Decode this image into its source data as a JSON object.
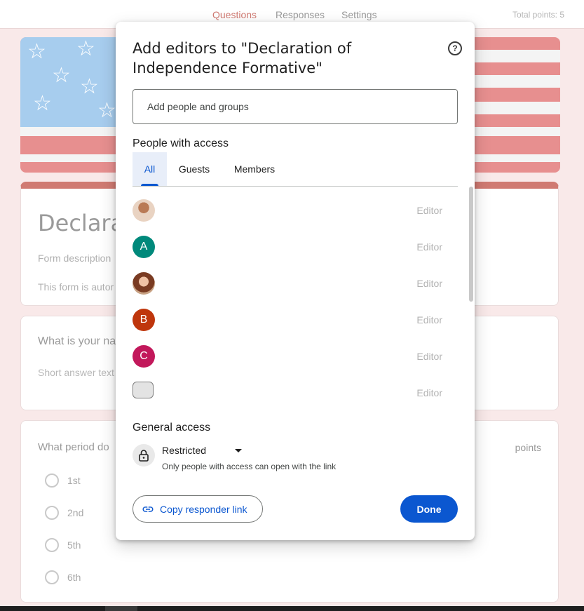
{
  "topbar": {
    "tabs": [
      "Questions",
      "Responses",
      "Settings"
    ],
    "total_points": "Total points: 5"
  },
  "form": {
    "title_visible": "Declarat",
    "description_placeholder": "Form description",
    "auto_text_visible": "This form is autor",
    "q1_label_visible": "What is your nar",
    "q1_answer_placeholder": "Short answer text",
    "q2_label_visible": "What period do",
    "q2_points": "points",
    "q2_options": [
      "1st",
      "2nd",
      "5th",
      "6th"
    ]
  },
  "dialog": {
    "title": "Add editors to \"Declaration of Independence Formative\"",
    "help_icon": "help-circle-icon",
    "add_placeholder": "Add people and groups",
    "people_heading": "People with access",
    "tabs": [
      "All",
      "Guests",
      "Members"
    ],
    "active_tab": "All",
    "people": [
      {
        "avatar": "photo",
        "initial": "",
        "role": "Editor"
      },
      {
        "avatar": "letter",
        "initial": "A",
        "color": "#00897b",
        "role": "Editor"
      },
      {
        "avatar": "photo",
        "initial": "",
        "role": "Editor"
      },
      {
        "avatar": "letter",
        "initial": "B",
        "color": "#bf360c",
        "role": "Editor"
      },
      {
        "avatar": "letter",
        "initial": "C",
        "color": "#c2185b",
        "role": "Editor"
      },
      {
        "avatar": "photo",
        "initial": "",
        "role": "Editor"
      }
    ],
    "general_access_heading": "General access",
    "access_level": "Restricted",
    "access_description": "Only people with access can open with the link",
    "copy_link_label": "Copy responder link",
    "done_label": "Done",
    "accent_color": "#0b57d0"
  }
}
